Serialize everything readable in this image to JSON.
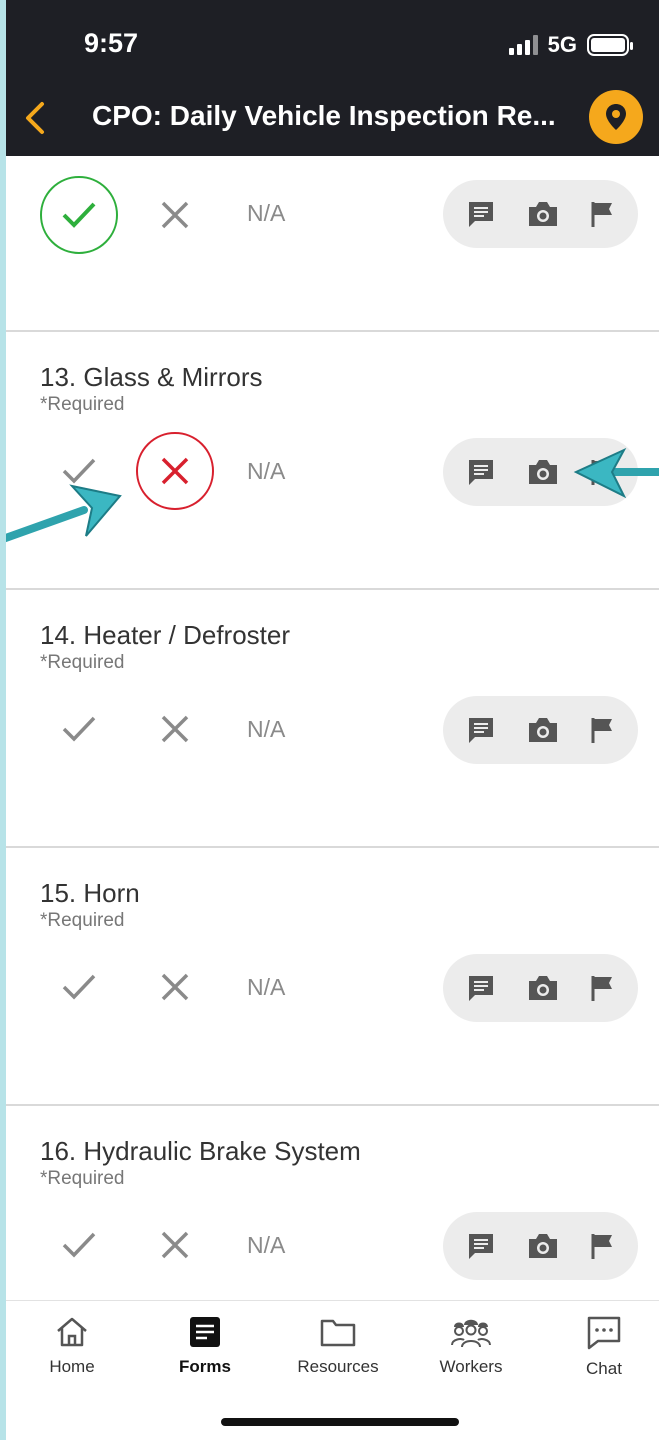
{
  "status_bar": {
    "time": "9:57",
    "network": "5G"
  },
  "header": {
    "title": "CPO: Daily Vehicle Inspection Re...",
    "back_icon": "chevron-left-icon",
    "location_icon": "map-pin-icon",
    "accent_color": "#f5a81c"
  },
  "items": [
    {
      "title": "",
      "required": "",
      "selected": "pass",
      "na_label": "N/A"
    },
    {
      "title": "13. Glass & Mirrors",
      "required": "*Required",
      "selected": "fail",
      "na_label": "N/A"
    },
    {
      "title": "14. Heater / Defroster",
      "required": "*Required",
      "selected": "none",
      "na_label": "N/A"
    },
    {
      "title": "15. Horn",
      "required": "*Required",
      "selected": "none",
      "na_label": "N/A"
    },
    {
      "title": "16. Hydraulic Brake System",
      "required": "*Required",
      "selected": "none",
      "na_label": "N/A"
    }
  ],
  "colors": {
    "pass": "#2eaf3c",
    "fail": "#d8202e",
    "neutral": "#8a8a8a"
  },
  "bottom_nav": {
    "tabs": [
      {
        "label": "Home",
        "icon": "home-icon"
      },
      {
        "label": "Forms",
        "icon": "forms-icon",
        "active": true
      },
      {
        "label": "Resources",
        "icon": "folder-icon"
      },
      {
        "label": "Workers",
        "icon": "workers-icon"
      },
      {
        "label": "Chat",
        "icon": "chat-icon"
      }
    ]
  }
}
